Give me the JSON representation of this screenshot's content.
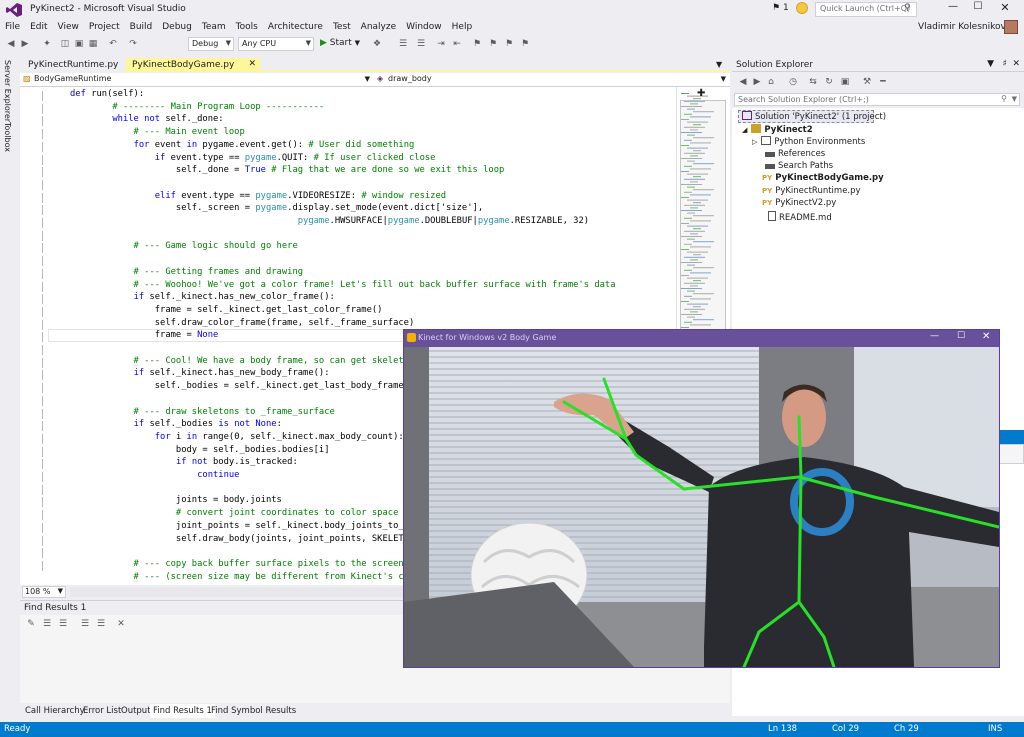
{
  "window": {
    "title": "PyKinect2 - Microsoft Visual Studio",
    "notification_count": "1",
    "quick_launch_placeholder": "Quick Launch (Ctrl+Q)",
    "user_name": "Vladimir Kolesnikov",
    "min_glyph": "—",
    "max_glyph": "☐",
    "close_glyph": "✕"
  },
  "menu": [
    "File",
    "Edit",
    "View",
    "Project",
    "Build",
    "Debug",
    "Team",
    "Tools",
    "Architecture",
    "Test",
    "Analyze",
    "Window",
    "Help"
  ],
  "toolbar": {
    "configuration": "Debug",
    "platform": "Any CPU",
    "start_label": "Start"
  },
  "left_rail": [
    "Server Explorer",
    "Toolbox"
  ],
  "editor": {
    "tabs": [
      {
        "label": "PyKinectRuntime.py",
        "active": false
      },
      {
        "label": "PyKinectBodyGame.py",
        "active": true
      }
    ],
    "nav_class": "BodyGameRuntime",
    "nav_member": "draw_body",
    "zoom": "108 %"
  },
  "code_lines": [
    [
      {
        "t": "def ",
        "c": "kw"
      },
      {
        "t": "run(self):",
        "c": ""
      }
    ],
    [
      {
        "t": "        # -------- Main Program Loop -----------",
        "c": "cm"
      }
    ],
    [
      {
        "t": "        ",
        "c": ""
      },
      {
        "t": "while not ",
        "c": "kw"
      },
      {
        "t": "self._done:",
        "c": ""
      }
    ],
    [
      {
        "t": "            # --- Main event loop",
        "c": "cm"
      }
    ],
    [
      {
        "t": "            ",
        "c": ""
      },
      {
        "t": "for ",
        "c": "kw"
      },
      {
        "t": "event ",
        "c": ""
      },
      {
        "t": "in ",
        "c": "kw"
      },
      {
        "t": "pygame.event.get(): ",
        "c": ""
      },
      {
        "t": "# User did something",
        "c": "cm"
      }
    ],
    [
      {
        "t": "                ",
        "c": ""
      },
      {
        "t": "if ",
        "c": "kw"
      },
      {
        "t": "event.type == ",
        "c": ""
      },
      {
        "t": "pygame",
        "c": "md"
      },
      {
        "t": ".QUIT: ",
        "c": ""
      },
      {
        "t": "# If user clicked close",
        "c": "cm"
      }
    ],
    [
      {
        "t": "                    self._done = ",
        "c": ""
      },
      {
        "t": "True ",
        "c": "kw"
      },
      {
        "t": "# Flag that we are done so we exit this loop",
        "c": "cm"
      }
    ],
    [
      {
        "t": "",
        "c": ""
      }
    ],
    [
      {
        "t": "                ",
        "c": ""
      },
      {
        "t": "elif ",
        "c": "kw"
      },
      {
        "t": "event.type == ",
        "c": ""
      },
      {
        "t": "pygame",
        "c": "md"
      },
      {
        "t": ".VIDEORESIZE: ",
        "c": ""
      },
      {
        "t": "# window resized",
        "c": "cm"
      }
    ],
    [
      {
        "t": "                    self._screen = ",
        "c": ""
      },
      {
        "t": "pygame",
        "c": "md"
      },
      {
        "t": ".display.set_mode(event.dict['size'],",
        "c": ""
      }
    ],
    [
      {
        "t": "                                           ",
        "c": ""
      },
      {
        "t": "pygame",
        "c": "md"
      },
      {
        "t": ".HWSURFACE|",
        "c": ""
      },
      {
        "t": "pygame",
        "c": "md"
      },
      {
        "t": ".DOUBLEBUF|",
        "c": ""
      },
      {
        "t": "pygame",
        "c": "md"
      },
      {
        "t": ".RESIZABLE, 32)",
        "c": ""
      }
    ],
    [
      {
        "t": "",
        "c": ""
      }
    ],
    [
      {
        "t": "            # --- Game logic should go here",
        "c": "cm"
      }
    ],
    [
      {
        "t": "",
        "c": ""
      }
    ],
    [
      {
        "t": "            # --- Getting frames and drawing",
        "c": "cm"
      }
    ],
    [
      {
        "t": "            # --- Woohoo! We've got a color frame! Let's fill out back buffer surface with frame's data",
        "c": "cm"
      }
    ],
    [
      {
        "t": "            ",
        "c": ""
      },
      {
        "t": "if ",
        "c": "kw"
      },
      {
        "t": "self._kinect.has_new_color_frame():",
        "c": ""
      }
    ],
    [
      {
        "t": "                frame = self._kinect.get_last_color_frame()",
        "c": ""
      }
    ],
    [
      {
        "t": "                self.draw_color_frame(frame, self._frame_surface)",
        "c": ""
      }
    ],
    [
      {
        "t": "                frame = ",
        "c": ""
      },
      {
        "t": "None",
        "c": "kw"
      }
    ],
    [
      {
        "t": "",
        "c": ""
      }
    ],
    [
      {
        "t": "            # --- Cool! We have a body frame, so can get skeletons",
        "c": "cm"
      }
    ],
    [
      {
        "t": "            ",
        "c": ""
      },
      {
        "t": "if ",
        "c": "kw"
      },
      {
        "t": "self._kinect.has_new_body_frame():",
        "c": ""
      }
    ],
    [
      {
        "t": "                self._bodies = self._kinect.get_last_body_frame()",
        "c": ""
      }
    ],
    [
      {
        "t": "",
        "c": ""
      }
    ],
    [
      {
        "t": "            # --- draw skeletons to _frame_surface",
        "c": "cm"
      }
    ],
    [
      {
        "t": "            ",
        "c": ""
      },
      {
        "t": "if ",
        "c": "kw"
      },
      {
        "t": "self._bodies ",
        "c": ""
      },
      {
        "t": "is not None",
        "c": "kw"
      },
      {
        "t": ":",
        "c": ""
      }
    ],
    [
      {
        "t": "                ",
        "c": ""
      },
      {
        "t": "for ",
        "c": "kw"
      },
      {
        "t": "i ",
        "c": ""
      },
      {
        "t": "in ",
        "c": "kw"
      },
      {
        "t": "range(0, self._kinect.max_body_count):",
        "c": ""
      }
    ],
    [
      {
        "t": "                    body = self._bodies.bodies[i]",
        "c": ""
      }
    ],
    [
      {
        "t": "                    ",
        "c": ""
      },
      {
        "t": "if not ",
        "c": "kw"
      },
      {
        "t": "body.is_tracked:",
        "c": ""
      }
    ],
    [
      {
        "t": "                        ",
        "c": ""
      },
      {
        "t": "continue",
        "c": "kw"
      }
    ],
    [
      {
        "t": "",
        "c": ""
      }
    ],
    [
      {
        "t": "                    joints = body.joints",
        "c": ""
      }
    ],
    [
      {
        "t": "                    # convert joint coordinates to color space",
        "c": "cm"
      }
    ],
    [
      {
        "t": "                    joint_points = self._kinect.body_joints_to_colo",
        "c": ""
      }
    ],
    [
      {
        "t": "                    self.draw_body(joints, joint_points, SKELETON_C",
        "c": ""
      }
    ],
    [
      {
        "t": "",
        "c": ""
      }
    ],
    [
      {
        "t": "            # --- copy back buffer surface pixels to the screen, re",
        "c": "cm"
      }
    ],
    [
      {
        "t": "            # --- (screen size may be different from Kinect's color",
        "c": "cm"
      }
    ]
  ],
  "find_panel": {
    "title": "Find Results 1"
  },
  "bottom_tabs": [
    "Call Hierarchy",
    "Error List",
    "Output",
    "Find Results 1",
    "Find Symbol Results"
  ],
  "solution_explorer": {
    "title": "Solution Explorer",
    "search_placeholder": "Search Solution Explorer (Ctrl+;)",
    "items": [
      {
        "label": "Solution 'PyKinect2' (1 project)",
        "bold": false
      },
      {
        "label": "PyKinect2",
        "bold": true
      },
      {
        "label": "Python Environments",
        "bold": false
      },
      {
        "label": "References",
        "bold": false
      },
      {
        "label": "Search Paths",
        "bold": false
      },
      {
        "label": "PyKinectBodyGame.py",
        "bold": true
      },
      {
        "label": "PyKinectRuntime.py",
        "bold": false
      },
      {
        "label": "PyKinectV2.py",
        "bold": false
      },
      {
        "label": "README.md",
        "bold": false
      }
    ]
  },
  "kinect_window": {
    "title": "Kinect for Windows v2 Body Game",
    "skeleton_color": "#28e028"
  },
  "statusbar": {
    "state": "Ready",
    "line": "Ln 138",
    "col": "Col 29",
    "ch": "Ch 29",
    "mode": "INS"
  },
  "colors": {
    "accent": "#007acc",
    "active_tab": "#fef69a",
    "kinect_titlebar": "#68509b"
  }
}
